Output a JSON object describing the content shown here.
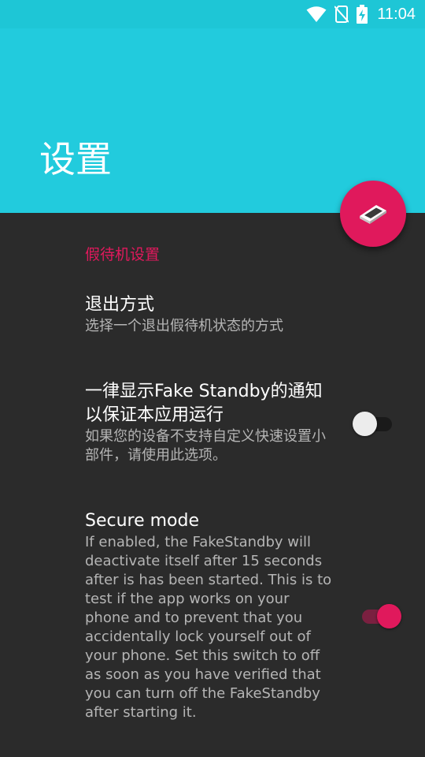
{
  "status_bar": {
    "time": "11:04",
    "icons": [
      "wifi-icon",
      "no-sim-icon",
      "battery-charging-icon"
    ]
  },
  "app_bar": {
    "title": "设置"
  },
  "fab": {
    "icon": "standby-phone-icon"
  },
  "settings": {
    "category": "假待机设置",
    "exit_method": {
      "title": "退出方式",
      "summary": "选择一个退出假待机状态的方式"
    },
    "always_notify": {
      "title": "一律显示Fake Standby的通知以保证本应用运行",
      "summary": "如果您的设备不支持自定义快速设置小部件，请使用此选项。",
      "enabled": false
    },
    "secure_mode": {
      "title": "Secure mode",
      "summary": "If enabled, the FakeStandby will deactivate itself after 15 seconds after is has been started. This is to test if the app works on your phone and to prevent that you accidentally lock yourself out of your phone. Set this switch to off as soon as you have verified that you can turn off the FakeStandby after starting it.",
      "enabled": true
    }
  },
  "colors": {
    "primary": "#22cbdd",
    "accent": "#e0195c",
    "background": "#2b2b2b"
  }
}
